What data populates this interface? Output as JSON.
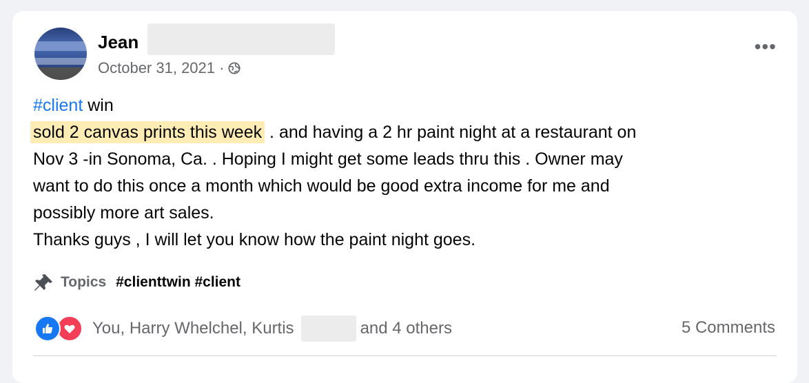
{
  "post": {
    "author": "Jean",
    "date": "October 31, 2021 ·",
    "audience_icon": "globe-icon",
    "more_options": "•••",
    "lines": {
      "line1_tag": "#client",
      "line1_rest": " win",
      "highlight": "sold 2 canvas prints this week",
      "line2_rest": " . and having a 2 hr paint night  at a restaurant on",
      "line3": "Nov 3 -in Sonoma, Ca. . Hoping I might get some leads thru this . Owner may",
      "line4": "want to do this once a month which would be  good extra income for me and",
      "line5": "possibly more  art sales.",
      "line6": "Thanks guys , I will let you know how the paint night goes."
    },
    "topics": {
      "icon": "pin-icon",
      "label": "Topics",
      "tags": "#clienttwin #client"
    },
    "reactions": {
      "icons": [
        "like-icon",
        "love-icon"
      ],
      "names_prefix": "You, Harry Whelchel, Kurtis",
      "names_suffix": "and 4 others",
      "comments": "5 Comments"
    },
    "colors": {
      "hashtag": "#1877f2",
      "highlight": "#fdedb5",
      "like": "#1877f2",
      "love": "#f33e58"
    }
  }
}
